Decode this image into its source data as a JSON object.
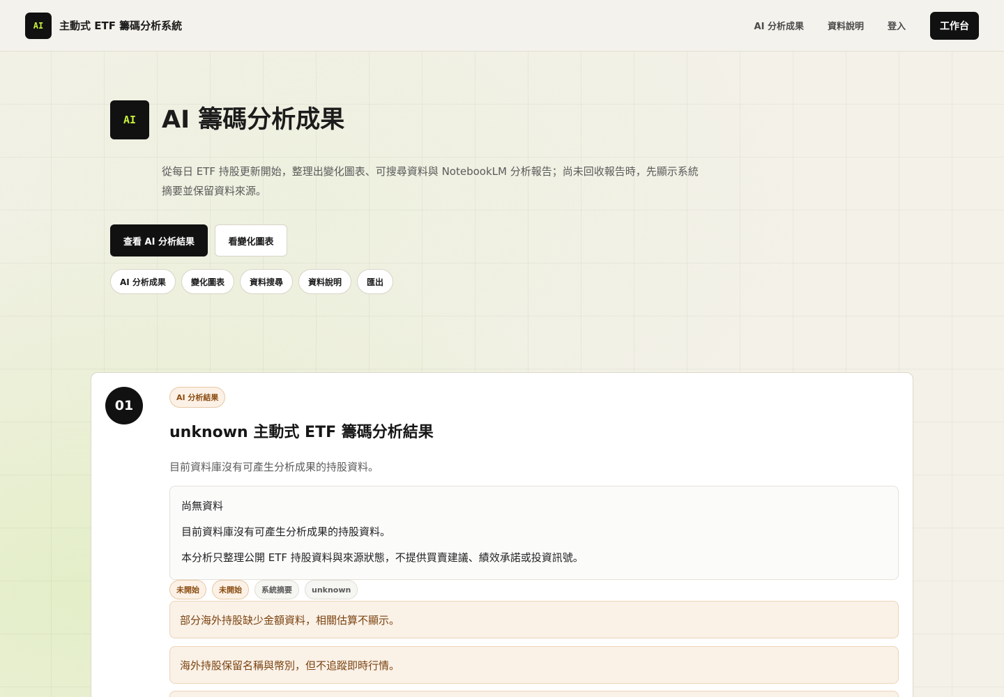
{
  "header": {
    "logo": "AI",
    "brand": "主動式 ETF 籌碼分析系統",
    "nav": [
      "AI 分析成果",
      "資料說明",
      "登入"
    ],
    "cta": "工作台"
  },
  "hero": {
    "badge": "AI",
    "title": "AI 籌碼分析成果",
    "description": "從每日 ETF 持股更新開始，整理出變化圖表、可搜尋資料與 NotebookLM 分析報告；尚未回收報告時，先顯示系統摘要並保留資料來源。",
    "primary_button": "查看 AI 分析結果",
    "secondary_button": "看變化圖表",
    "pills": [
      "AI 分析成果",
      "變化圖表",
      "資料搜尋",
      "資料說明",
      "匯出"
    ]
  },
  "card": {
    "step": "01",
    "tag": "AI 分析結果",
    "title": "unknown 主動式 ETF 籌碼分析結果",
    "subtitle": "目前資料庫沒有可產生分析成果的持股資料。",
    "info_lines": [
      "尚無資料",
      "目前資料庫沒有可產生分析成果的持股資料。",
      "本分析只整理公開 ETF 持股資料與來源狀態，不提供買賣建議、績效承諾或投資訊號。"
    ],
    "chips": [
      "未開始",
      "未開始",
      "系統摘要",
      "unknown"
    ],
    "notes": [
      "部分海外持股缺少金額資料，相關估算不顯示。",
      "海外持股保留名稱與幣別，但不追蹤即時行情。"
    ]
  }
}
